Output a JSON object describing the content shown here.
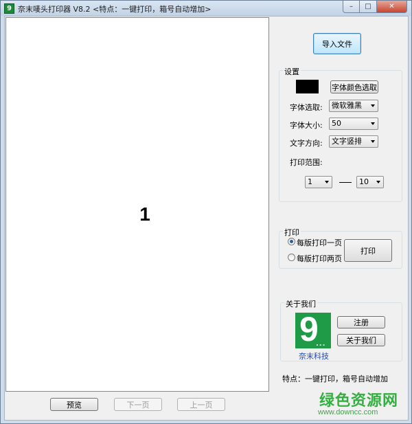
{
  "window": {
    "title": "奈末唛头打印器 V8.2  <特点：一键打印，箱号自动增加>",
    "app_icon_glyph": "9",
    "minimize_glyph": "–",
    "maximize_glyph": "□",
    "close_glyph": "✕"
  },
  "preview": {
    "number": "1"
  },
  "bottom_buttons": {
    "preview": "预览",
    "next_page": "下一页",
    "prev_page": "上一页"
  },
  "import_button": "导入文件",
  "settings": {
    "group_title": "设置",
    "font_color_swatch": "#000000",
    "font_color_button": "字体颜色选取",
    "font_select_label": "字体选取:",
    "font_select_value": "微软雅黑",
    "font_size_label": "字体大小:",
    "font_size_value": "50",
    "text_direction_label": "文字方向:",
    "text_direction_value": "文字竖排",
    "print_range_label": "打印范围:",
    "range_from": "1",
    "range_to": "10"
  },
  "print": {
    "group_title": "打印",
    "option_one": "每版打印一页",
    "option_two": "每版打印两页",
    "selected_option": "one",
    "print_button": "打印"
  },
  "about": {
    "group_title": "关于我们",
    "logo_glyph": "9",
    "logo_dots": "...",
    "logo_caption": "奈末科技",
    "register_button": "注册",
    "about_button": "关于我们"
  },
  "footer_text": "特点：一键打印，箱号自动增加",
  "watermark": {
    "title": "绿色资源网",
    "url": "www.downcc.com"
  },
  "colors": {
    "logo_green": "#1f9a47",
    "caption_blue": "#1e49b8",
    "watermark_green": "#34b041"
  }
}
